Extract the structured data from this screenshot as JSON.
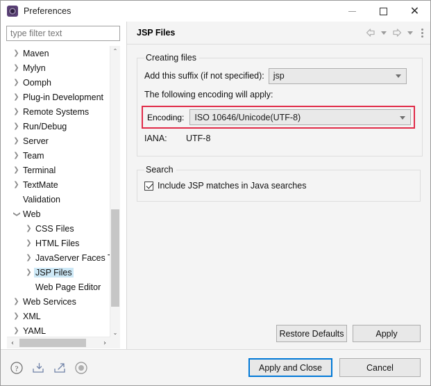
{
  "window": {
    "title": "Preferences",
    "icon": "preferences-gear-icon",
    "controls": {
      "minimize": "—",
      "maximize": "□",
      "close": "✕"
    }
  },
  "filter": {
    "placeholder": "type filter text",
    "value": ""
  },
  "tree": {
    "items": [
      {
        "label": "Maven",
        "level": 1,
        "twisty": "collapsed",
        "selected": false
      },
      {
        "label": "Mylyn",
        "level": 1,
        "twisty": "collapsed",
        "selected": false
      },
      {
        "label": "Oomph",
        "level": 1,
        "twisty": "collapsed",
        "selected": false
      },
      {
        "label": "Plug-in Development",
        "level": 1,
        "twisty": "collapsed",
        "selected": false
      },
      {
        "label": "Remote Systems",
        "level": 1,
        "twisty": "collapsed",
        "selected": false
      },
      {
        "label": "Run/Debug",
        "level": 1,
        "twisty": "collapsed",
        "selected": false
      },
      {
        "label": "Server",
        "level": 1,
        "twisty": "collapsed",
        "selected": false
      },
      {
        "label": "Team",
        "level": 1,
        "twisty": "collapsed",
        "selected": false
      },
      {
        "label": "Terminal",
        "level": 1,
        "twisty": "collapsed",
        "selected": false
      },
      {
        "label": "TextMate",
        "level": 1,
        "twisty": "collapsed",
        "selected": false
      },
      {
        "label": "Validation",
        "level": 1,
        "twisty": "none",
        "selected": false
      },
      {
        "label": "Web",
        "level": 1,
        "twisty": "expanded",
        "selected": false
      },
      {
        "label": "CSS Files",
        "level": 2,
        "twisty": "collapsed",
        "selected": false
      },
      {
        "label": "HTML Files",
        "level": 2,
        "twisty": "collapsed",
        "selected": false
      },
      {
        "label": "JavaServer Faces To",
        "level": 2,
        "twisty": "collapsed",
        "selected": false
      },
      {
        "label": "JSP Files",
        "level": 2,
        "twisty": "collapsed",
        "selected": true
      },
      {
        "label": "Web Page Editor",
        "level": 2,
        "twisty": "none",
        "selected": false
      },
      {
        "label": "Web Services",
        "level": 1,
        "twisty": "collapsed",
        "selected": false
      },
      {
        "label": "XML",
        "level": 1,
        "twisty": "collapsed",
        "selected": false
      },
      {
        "label": "YAML",
        "level": 1,
        "twisty": "collapsed",
        "selected": false
      }
    ],
    "scroll_up_glyph": "⌃",
    "scroll_down_glyph": "⌄",
    "scroll_left_glyph": "‹",
    "scroll_right_glyph": "›"
  },
  "panel": {
    "title": "JSP Files",
    "toolbar": {
      "back": "back-arrow-icon",
      "forward": "forward-arrow-icon",
      "menu": "view-menu-icon"
    },
    "creating_files": {
      "legend": "Creating files",
      "suffix_label": "Add this suffix (if not specified):",
      "suffix_value": "jsp",
      "encoding_note": "The following encoding will apply:",
      "encoding_label": "Encoding:",
      "encoding_value": "ISO 10646/Unicode(UTF-8)",
      "iana_label": "IANA:",
      "iana_value": "UTF-8",
      "highlight_color": "#e02b48"
    },
    "search": {
      "legend": "Search",
      "checkbox_label": "Include JSP matches in Java searches",
      "checked": true
    },
    "restore_defaults_label": "Restore Defaults",
    "apply_label": "Apply"
  },
  "footer": {
    "icons": [
      {
        "name": "help-icon"
      },
      {
        "name": "import-icon"
      },
      {
        "name": "export-icon"
      },
      {
        "name": "record-icon"
      }
    ],
    "apply_and_close_label": "Apply and Close",
    "cancel_label": "Cancel",
    "focus_color": "#0078d7"
  }
}
